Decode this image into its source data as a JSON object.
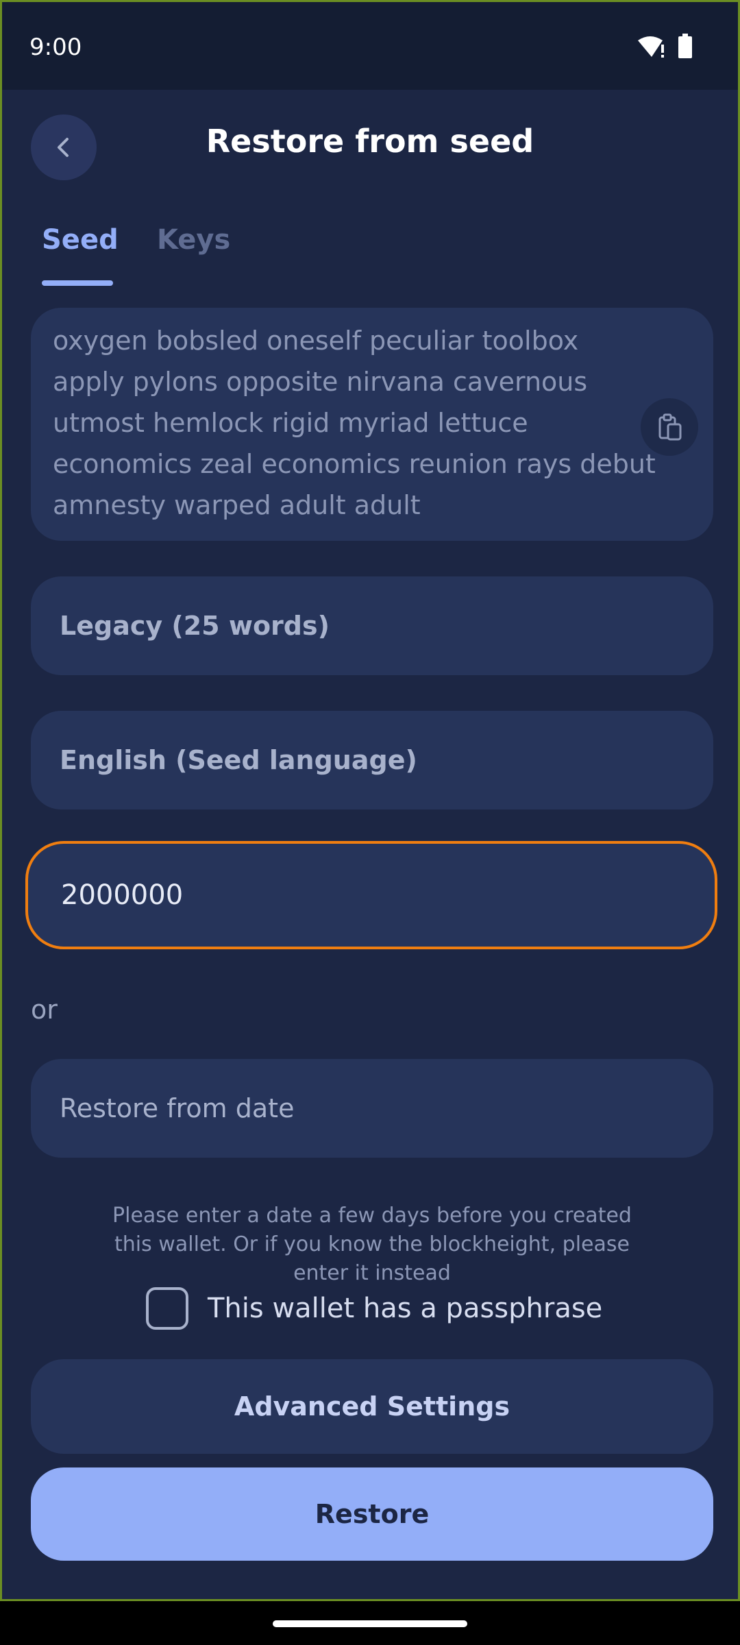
{
  "status_bar": {
    "time": "9:00",
    "wifi_icon": "wifi-alert-icon",
    "battery_icon": "battery-full-icon"
  },
  "header": {
    "title": "Restore from seed",
    "back_icon": "chevron-left-icon"
  },
  "tabs": [
    {
      "label": "Seed",
      "active": true
    },
    {
      "label": "Keys",
      "active": false
    }
  ],
  "seed": {
    "text": "oxygen bobsled oneself peculiar toolbox apply pylons opposite nirvana cavernous utmost hemlock rigid myriad lettuce economics zeal economics reunion rays debut amnesty warped adult adult",
    "paste_icon": "clipboard-icon"
  },
  "seed_type": {
    "value": "Legacy (25 words)"
  },
  "seed_language": {
    "value": "English (Seed language)"
  },
  "block_height": {
    "value": "2000000"
  },
  "or_label": "or",
  "restore_date": {
    "placeholder": "Restore from date"
  },
  "helper_text": "Please enter a date a few days before you created this wallet. Or if you know the blockheight, please enter it instead",
  "passphrase": {
    "label": "This wallet has a passphrase",
    "checked": false
  },
  "buttons": {
    "advanced": "Advanced Settings",
    "restore": "Restore"
  },
  "colors": {
    "background": "#1c2644",
    "accent": "#93aef8",
    "focus_border": "#f07e10"
  }
}
